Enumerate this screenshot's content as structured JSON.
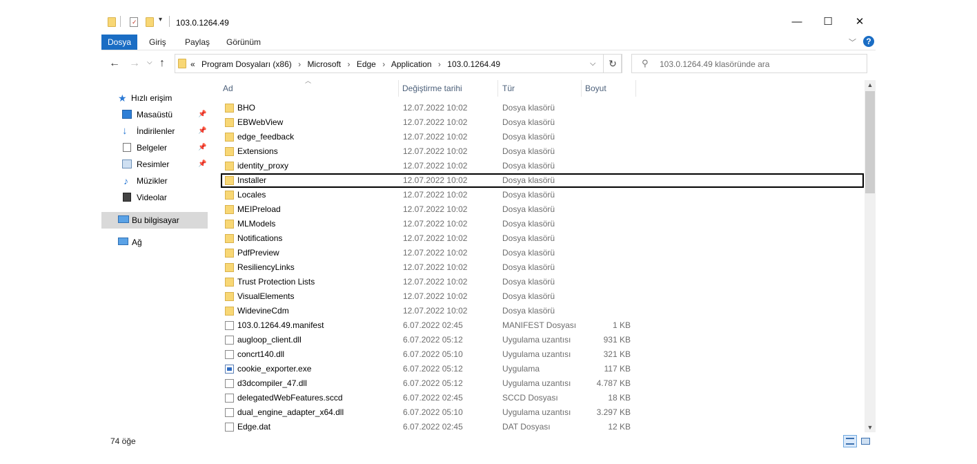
{
  "window": {
    "title": "103.0.1264.49",
    "controls": {
      "minimize": "—",
      "maximize": "☐",
      "close": "✕"
    }
  },
  "ribbon": {
    "tabs": [
      "Dosya",
      "Giriş",
      "Paylaş",
      "Görünüm"
    ],
    "active_tab": "Dosya",
    "help": "?"
  },
  "address": {
    "overflow": "«",
    "crumbs": [
      "Program Dosyaları (x86)",
      "Microsoft",
      "Edge",
      "Application",
      "103.0.1264.49"
    ],
    "separator": "›"
  },
  "search": {
    "placeholder": "103.0.1264.49 klasöründe ara"
  },
  "sidebar": {
    "quick_access": "Hızlı erişim",
    "items": [
      "Masaüstü",
      "İndirilenler",
      "Belgeler",
      "Resimler",
      "Müzikler",
      "Videolar"
    ],
    "this_pc": "Bu bilgisayar",
    "network": "Ağ"
  },
  "columns": {
    "name": "Ad",
    "date": "Değiştirme tarihi",
    "type": "Tür",
    "size": "Boyut"
  },
  "files": [
    {
      "name": "BHO",
      "date": "12.07.2022 10:02",
      "type": "Dosya klasörü",
      "size": "",
      "icon": "folder"
    },
    {
      "name": "EBWebView",
      "date": "12.07.2022 10:02",
      "type": "Dosya klasörü",
      "size": "",
      "icon": "folder"
    },
    {
      "name": "edge_feedback",
      "date": "12.07.2022 10:02",
      "type": "Dosya klasörü",
      "size": "",
      "icon": "folder"
    },
    {
      "name": "Extensions",
      "date": "12.07.2022 10:02",
      "type": "Dosya klasörü",
      "size": "",
      "icon": "folder"
    },
    {
      "name": "identity_proxy",
      "date": "12.07.2022 10:02",
      "type": "Dosya klasörü",
      "size": "",
      "icon": "folder"
    },
    {
      "name": "Installer",
      "date": "12.07.2022 10:02",
      "type": "Dosya klasörü",
      "size": "",
      "icon": "folder"
    },
    {
      "name": "Locales",
      "date": "12.07.2022 10:02",
      "type": "Dosya klasörü",
      "size": "",
      "icon": "folder"
    },
    {
      "name": "MEIPreload",
      "date": "12.07.2022 10:02",
      "type": "Dosya klasörü",
      "size": "",
      "icon": "folder"
    },
    {
      "name": "MLModels",
      "date": "12.07.2022 10:02",
      "type": "Dosya klasörü",
      "size": "",
      "icon": "folder"
    },
    {
      "name": "Notifications",
      "date": "12.07.2022 10:02",
      "type": "Dosya klasörü",
      "size": "",
      "icon": "folder"
    },
    {
      "name": "PdfPreview",
      "date": "12.07.2022 10:02",
      "type": "Dosya klasörü",
      "size": "",
      "icon": "folder"
    },
    {
      "name": "ResiliencyLinks",
      "date": "12.07.2022 10:02",
      "type": "Dosya klasörü",
      "size": "",
      "icon": "folder"
    },
    {
      "name": "Trust Protection Lists",
      "date": "12.07.2022 10:02",
      "type": "Dosya klasörü",
      "size": "",
      "icon": "folder"
    },
    {
      "name": "VisualElements",
      "date": "12.07.2022 10:02",
      "type": "Dosya klasörü",
      "size": "",
      "icon": "folder"
    },
    {
      "name": "WidevineCdm",
      "date": "12.07.2022 10:02",
      "type": "Dosya klasörü",
      "size": "",
      "icon": "folder"
    },
    {
      "name": "103.0.1264.49.manifest",
      "date": "6.07.2022 02:45",
      "type": "MANIFEST Dosyası",
      "size": "1 KB",
      "icon": "file"
    },
    {
      "name": "augloop_client.dll",
      "date": "6.07.2022 05:12",
      "type": "Uygulama uzantısı",
      "size": "931 KB",
      "icon": "file"
    },
    {
      "name": "concrt140.dll",
      "date": "6.07.2022 05:10",
      "type": "Uygulama uzantısı",
      "size": "321 KB",
      "icon": "file"
    },
    {
      "name": "cookie_exporter.exe",
      "date": "6.07.2022 05:12",
      "type": "Uygulama",
      "size": "117 KB",
      "icon": "exe"
    },
    {
      "name": "d3dcompiler_47.dll",
      "date": "6.07.2022 05:12",
      "type": "Uygulama uzantısı",
      "size": "4.787 KB",
      "icon": "file"
    },
    {
      "name": "delegatedWebFeatures.sccd",
      "date": "6.07.2022 02:45",
      "type": "SCCD Dosyası",
      "size": "18 KB",
      "icon": "file"
    },
    {
      "name": "dual_engine_adapter_x64.dll",
      "date": "6.07.2022 05:10",
      "type": "Uygulama uzantısı",
      "size": "3.297 KB",
      "icon": "file"
    },
    {
      "name": "Edge.dat",
      "date": "6.07.2022 02:45",
      "type": "DAT Dosyası",
      "size": "12 KB",
      "icon": "file"
    }
  ],
  "focused_index": 5,
  "status": {
    "count": "74 öğe"
  }
}
